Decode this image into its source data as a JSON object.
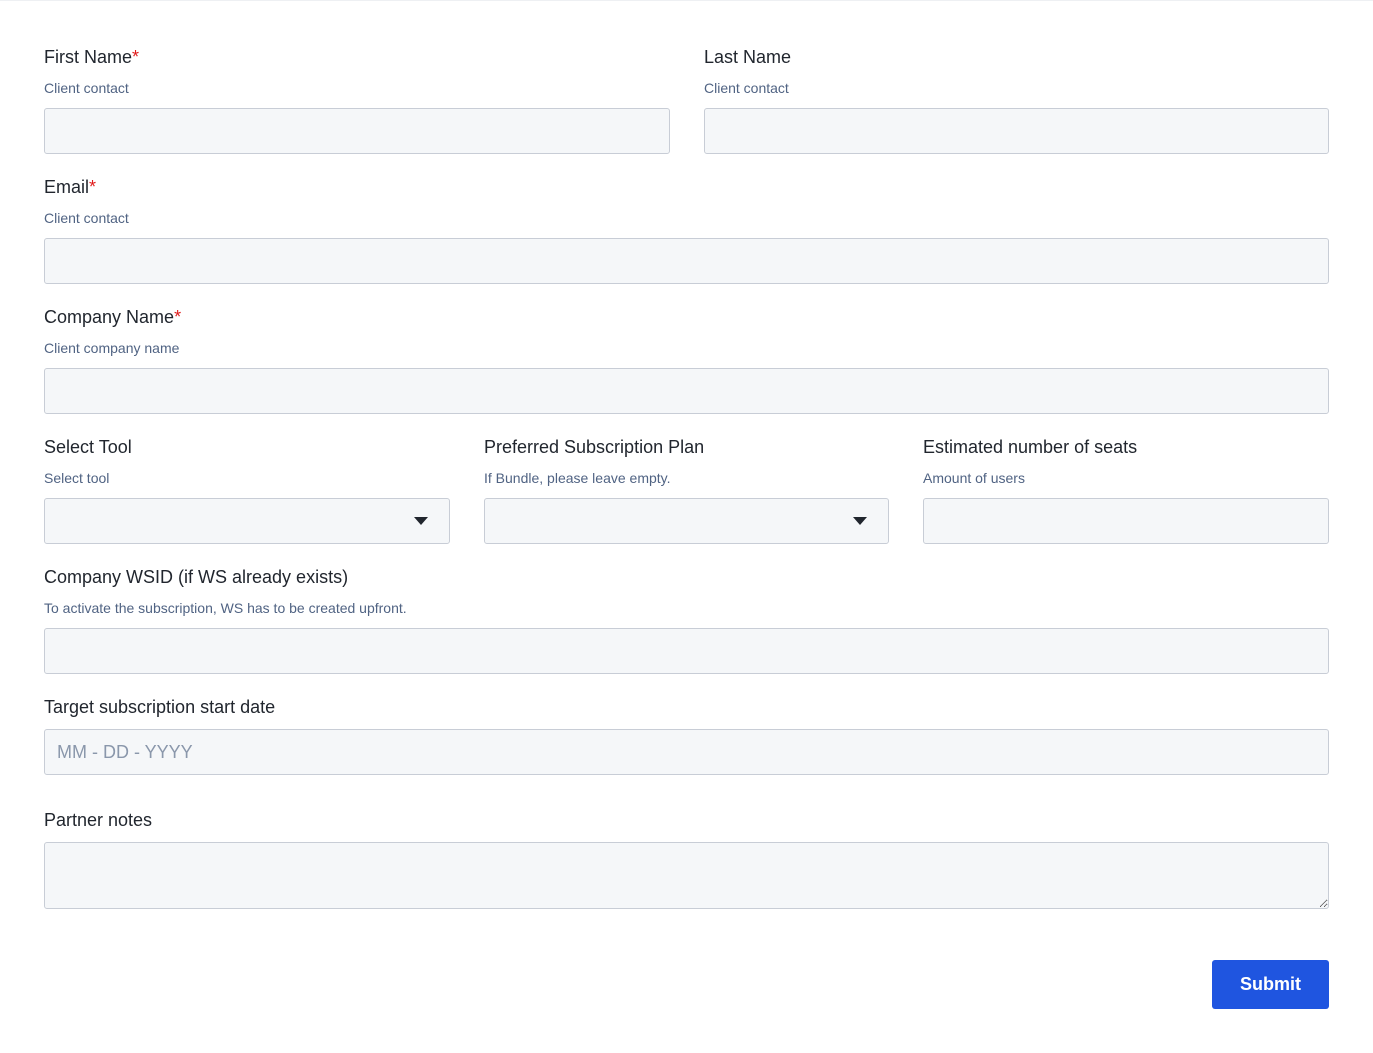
{
  "fields": {
    "first_name": {
      "label": "First Name",
      "required_mark": "*",
      "hint": "Client contact",
      "value": ""
    },
    "last_name": {
      "label": "Last Name",
      "hint": "Client contact",
      "value": ""
    },
    "email": {
      "label": "Email",
      "required_mark": "*",
      "hint": "Client contact",
      "value": ""
    },
    "company_name": {
      "label": "Company Name",
      "required_mark": "*",
      "hint": "Client company name",
      "value": ""
    },
    "select_tool": {
      "label": "Select Tool",
      "hint": "Select tool",
      "selected": ""
    },
    "subscription_plan": {
      "label": "Preferred Subscription Plan",
      "hint": "If Bundle, please leave empty.",
      "selected": ""
    },
    "seats": {
      "label": "Estimated number of seats",
      "hint": "Amount of users",
      "value": ""
    },
    "wsid": {
      "label": "Company WSID (if WS already exists)",
      "hint": "To activate the subscription, WS has to be created upfront.",
      "value": ""
    },
    "start_date": {
      "label": "Target subscription start date",
      "placeholder": "MM - DD - YYYY",
      "value": ""
    },
    "partner_notes": {
      "label": "Partner notes",
      "value": ""
    }
  },
  "submit": {
    "label": "Submit"
  },
  "colors": {
    "accent": "#1f55e0",
    "required": "#e01b1b",
    "hint_text": "#506383",
    "field_bg": "#f5f7f9",
    "field_border": "#c8cdd6"
  }
}
